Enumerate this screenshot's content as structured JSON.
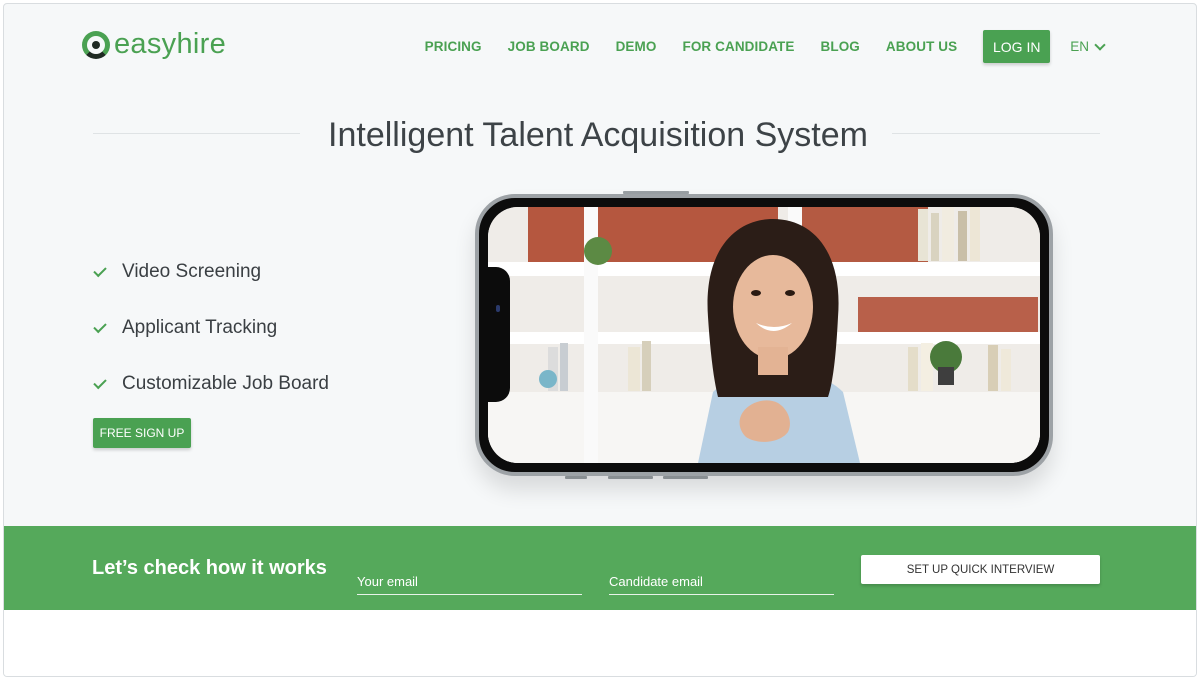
{
  "brand": {
    "name": "easyhire",
    "accent": "#4aa152"
  },
  "nav": {
    "items": [
      "PRICING",
      "JOB BOARD",
      "DEMO",
      "FOR CANDIDATE",
      "BLOG",
      "ABOUT US"
    ],
    "login_label": "LOG IN",
    "language": "EN"
  },
  "hero": {
    "headline": "Intelligent Talent Acquisition System",
    "features": [
      "Video Screening",
      "Applicant Tracking",
      "Customizable Job Board"
    ],
    "signup_label": "FREE SIGN UP"
  },
  "cta": {
    "title": "Let’s check how it works",
    "your_email_placeholder": "Your email",
    "candidate_email_placeholder": "Candidate email",
    "button_label": "SET UP QUICK INTERVIEW",
    "band_color": "#55a95b"
  }
}
